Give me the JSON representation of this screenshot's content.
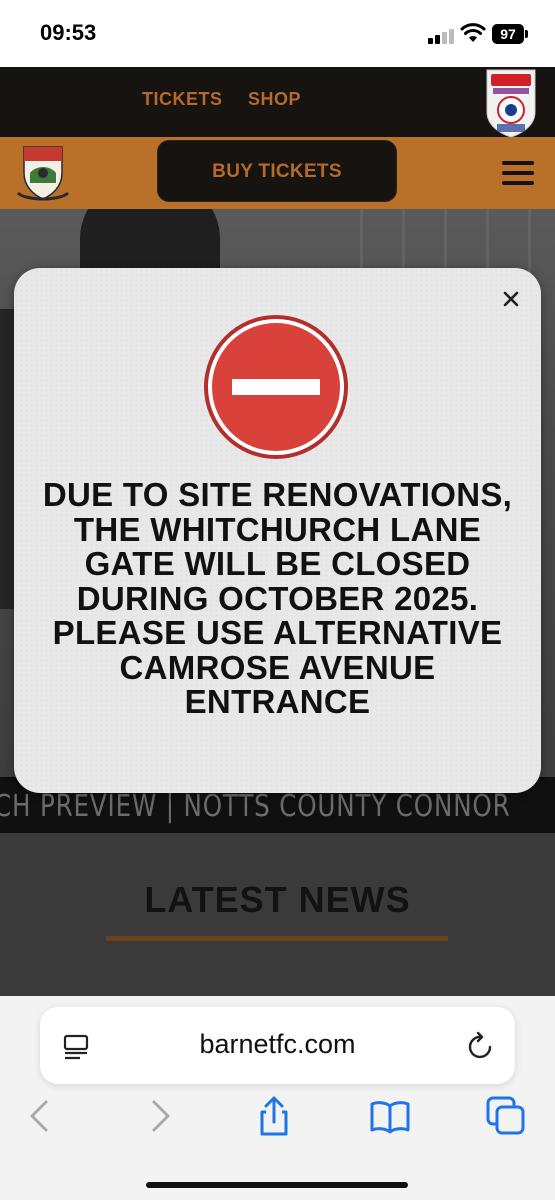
{
  "status_bar": {
    "time": "09:53",
    "battery": "97"
  },
  "top_nav": {
    "links": [
      "TICKETS",
      "SHOP"
    ]
  },
  "header": {
    "buy_tickets_label": "BUY TICKETS"
  },
  "ticker": {
    "text": "CH PREVIEW | NOTTS COUNTY    CONNOR"
  },
  "news": {
    "title": "LATEST NEWS"
  },
  "modal": {
    "message": "DUE TO SITE RENOVATIONS, THE WHITCHURCH LANE GATE WILL BE CLOSED DURING OCTOBER 2025. PLEASE USE ALTERNATIVE CAMROSE AVENUE ENTRANCE",
    "close_icon": "close-icon",
    "sign_icon": "no-entry-icon"
  },
  "browser": {
    "url": "barnetfc.com"
  },
  "colors": {
    "brand_amber": "#b97129",
    "dark": "#161310",
    "no_entry_red": "#d9413b"
  }
}
